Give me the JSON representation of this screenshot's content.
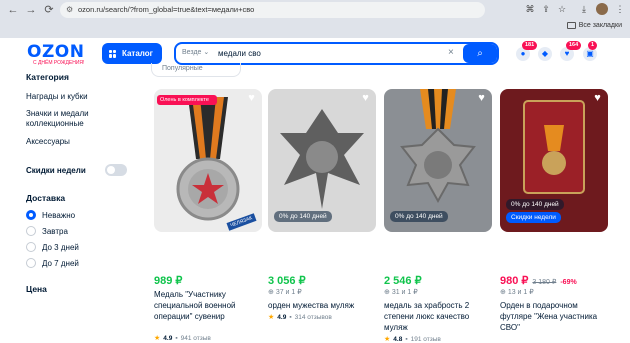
{
  "browser": {
    "url": "ozon.ru/search/?from_global=true&text=медали+сво",
    "bookmarks_label": "Все закладки",
    "back_icon": "←",
    "forward_icon": "→",
    "reload_icon": "⟳"
  },
  "header": {
    "logo": "OZON",
    "logo_sub": "С ДНЁМ РОЖДЕНИЯ!",
    "catalog_label": "Каталог",
    "search_scope": "Везде",
    "search_value": "медали сво",
    "badges": [
      "181",
      "164",
      "1"
    ],
    "sort_label": "Популярные"
  },
  "sidebar": {
    "category_heading": "Категория",
    "categories": [
      "Награды и кубки",
      "Значки и медали коллекционные",
      "Аксессуары"
    ],
    "week_discount_label": "Скидки недели",
    "delivery_heading": "Доставка",
    "delivery_options": [
      "Неважно",
      "Завтра",
      "До 3 дней",
      "До 7 дней"
    ],
    "price_heading": "Цена"
  },
  "products": [
    {
      "promo": "Олень в комплекте",
      "price": "989 ₽",
      "title": "Медаль \"Участнику специальной военной операции\" сувенир",
      "rating": "4.9",
      "reviews": "941 отзыв",
      "brand_tag": "ЧЕЛЯЗАК"
    },
    {
      "discount": "0% до 140 дней",
      "price": "3 056 ₽",
      "install": "37 и 1 ₽",
      "title": "орден мужества муляж",
      "rating": "4.9",
      "reviews": "314 отзывов"
    },
    {
      "discount": "0% до 140 дней",
      "price": "2 546 ₽",
      "install": "31 и 1 ₽",
      "title": "медаль за храбрость 2 степени люкс качество муляж",
      "rating": "4.8",
      "reviews": "191 отзыв"
    },
    {
      "discount": "0% до 140 дней",
      "week": "Скидки недели",
      "price": "980 ₽",
      "old_price": "3 180 ₽",
      "pct": "-69%",
      "install": "13 и 1 ₽",
      "title": "Орден в подарочном футляре \"Жена участника СВО\""
    }
  ]
}
